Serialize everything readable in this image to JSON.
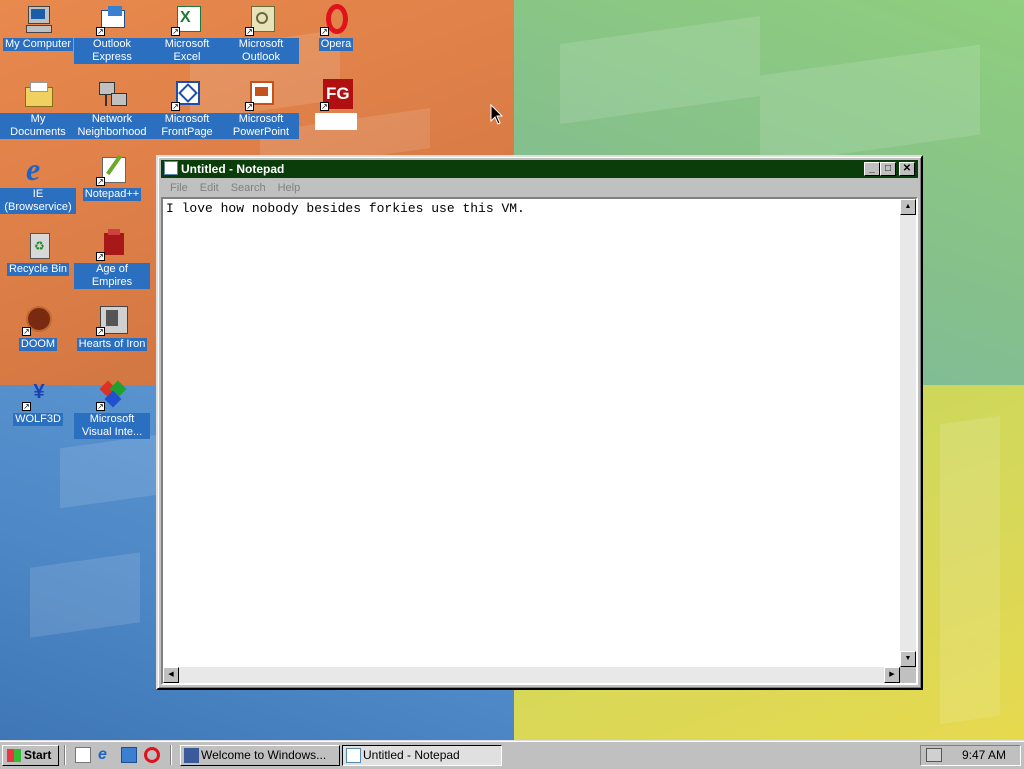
{
  "desktop": {
    "icons": [
      {
        "id": "my-computer",
        "label": "My Computer"
      },
      {
        "id": "outlook-express",
        "label": "Outlook Express"
      },
      {
        "id": "microsoft-excel",
        "label": "Microsoft Excel"
      },
      {
        "id": "microsoft-outlook",
        "label": "Microsoft Outlook"
      },
      {
        "id": "opera",
        "label": "Opera"
      },
      {
        "id": "my-documents",
        "label": "My Documents"
      },
      {
        "id": "network-neighborhood",
        "label": "Network Neighborhood"
      },
      {
        "id": "microsoft-frontpage",
        "label": "Microsoft FrontPage"
      },
      {
        "id": "microsoft-powerpoint",
        "label": "Microsoft PowerPoint"
      },
      {
        "id": "fg",
        "label": ""
      },
      {
        "id": "ie",
        "label": "IE (Browservice)"
      },
      {
        "id": "notepad-plus",
        "label": "Notepad++"
      },
      {
        "id": "recycle-bin",
        "label": "Recycle Bin"
      },
      {
        "id": "age-of-empires",
        "label": "Age of Empires"
      },
      {
        "id": "doom",
        "label": "DOOM"
      },
      {
        "id": "hearts-of-iron",
        "label": "Hearts of Iron"
      },
      {
        "id": "wolf3d",
        "label": "WOLF3D"
      },
      {
        "id": "ms-visual-inter",
        "label": "Microsoft Visual Inte..."
      }
    ]
  },
  "notepad": {
    "title": "Untitled - Notepad",
    "menu": [
      "File",
      "Edit",
      "Search",
      "Help"
    ],
    "content": "I love how nobody besides forkies use this VM.",
    "title_color": "#0a3d0a"
  },
  "taskbar": {
    "start_label": "Start",
    "tasks": [
      {
        "label": "Welcome to Windows..."
      },
      {
        "label": "Untitled - Notepad"
      }
    ],
    "clock": "9:47 AM"
  }
}
